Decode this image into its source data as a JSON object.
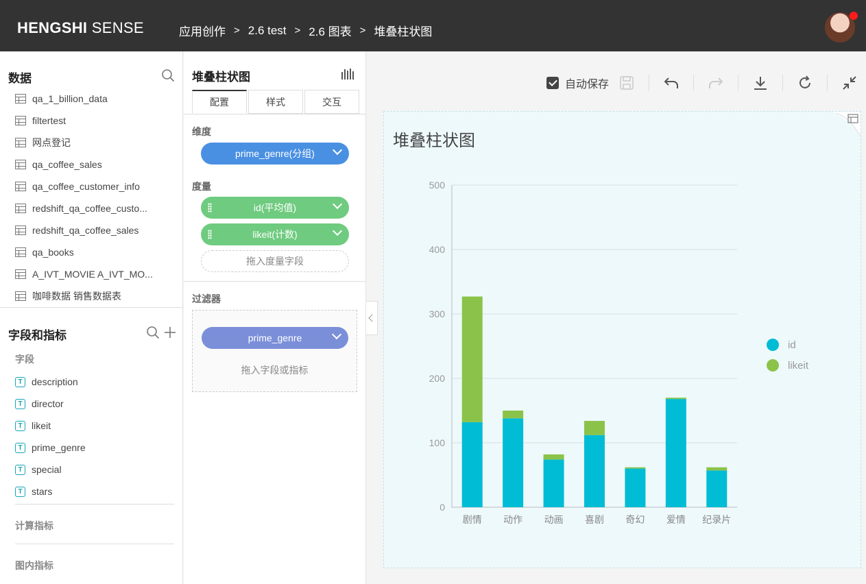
{
  "header": {
    "logo_bold": "HENGSHI",
    "logo_rest": " SENSE",
    "breadcrumb": [
      "应用创作",
      "2.6 test",
      "2.6 图表",
      "堆叠柱状图"
    ],
    "separator": ">"
  },
  "data_panel": {
    "title": "数据",
    "tables": [
      "qa_1_billion_data",
      "filtertest",
      "网点登记",
      "qa_coffee_sales",
      "qa_coffee_customer_info",
      "redshift_qa_coffee_custo...",
      "redshift_qa_coffee_sales",
      "qa_books",
      "A_IVT_MOVIE A_IVT_MO...",
      "咖啡数据 销售数据表"
    ]
  },
  "fields_panel": {
    "title": "字段和指标",
    "fields_label": "字段",
    "fields": [
      "description",
      "director",
      "likeit",
      "prime_genre",
      "special",
      "stars"
    ],
    "field_icon": "T",
    "calc_label": "计算指标",
    "inner_label": "图内指标"
  },
  "config": {
    "title": "堆叠柱状图",
    "tabs": [
      "配置",
      "样式",
      "交互"
    ],
    "dimension_label": "维度",
    "dimension": "prime_genre(分组)",
    "measure_label": "度量",
    "measures": [
      "id(平均值)",
      "likeit(计数)"
    ],
    "measure_drop": "拖入度量字段",
    "filter_label": "过滤器",
    "filter": "prime_genre",
    "filter_drop": "拖入字段或指标",
    "colors": {
      "dimension": "#4a90e2",
      "measure": "#6fcb7f",
      "filter": "#7b8fd9"
    }
  },
  "toolbar": {
    "autosave_label": "自动保存",
    "autosave_checked": true,
    "icons": [
      "save-icon",
      "undo-icon",
      "redo-icon",
      "download-icon",
      "refresh-icon",
      "collapse-icon"
    ]
  },
  "card": {
    "title": "堆叠柱状图"
  },
  "chart_data": {
    "type": "bar",
    "stacked": true,
    "categories": [
      "剧情",
      "动作",
      "动画",
      "喜剧",
      "奇幻",
      "爱情",
      "纪录片"
    ],
    "series": [
      {
        "name": "id",
        "color": "#00bcd4",
        "values": [
          132,
          138,
          74,
          112,
          60,
          168,
          57
        ]
      },
      {
        "name": "likeit",
        "color": "#8bc34a",
        "values": [
          195,
          12,
          8,
          22,
          2,
          2,
          5
        ]
      }
    ],
    "yticks": [
      0,
      100,
      200,
      300,
      400,
      500
    ],
    "ylim": [
      0,
      500
    ],
    "grid": true,
    "legend": "right"
  }
}
